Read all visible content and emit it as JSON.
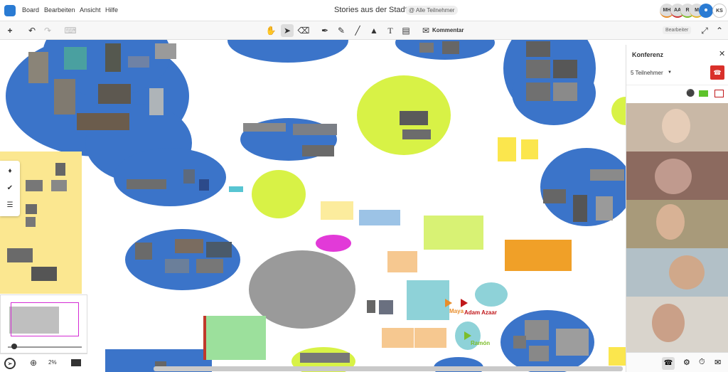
{
  "menu": {
    "board": "Board",
    "edit": "Bearbeiten",
    "view": "Ansicht",
    "help": "Hilfe"
  },
  "board": {
    "title": "Stories aus der Stadt",
    "share": "@ Alle Teilnehmer"
  },
  "avatars": [
    "MH",
    "AA",
    "R",
    "M",
    "KS"
  ],
  "toolbar": {
    "comment": "Kommentar",
    "editors": "Bearbeiter"
  },
  "conference": {
    "title": "Konferenz",
    "participants": "5 Teilnehmer"
  },
  "zoom": "2%",
  "cursors": {
    "maya": "Maya",
    "adam": "Adam Azaar",
    "ramon": "Ramón"
  },
  "colors": {
    "cloud_blue": "#3b74c9",
    "cloud_lime": "#d8f246",
    "sticky_yellow": "#fbe64d",
    "hangup_red": "#d9302a"
  },
  "icons": [
    "logo-icon",
    "plus-icon",
    "undo-icon",
    "redo-icon",
    "format-icon",
    "hand-icon",
    "pointer-icon",
    "eraser-icon",
    "pen-icon",
    "marker-icon",
    "line-icon",
    "shapes-icon",
    "text-icon",
    "note-icon",
    "comment-icon",
    "collapse-icon",
    "chevron-up-icon",
    "bell-icon",
    "check-icon",
    "list-icon",
    "zoom-in-icon",
    "present-icon",
    "mic-icon",
    "camera-icon",
    "screen-share-icon",
    "phone-icon",
    "settings-icon",
    "timer-icon",
    "chat-icon"
  ]
}
